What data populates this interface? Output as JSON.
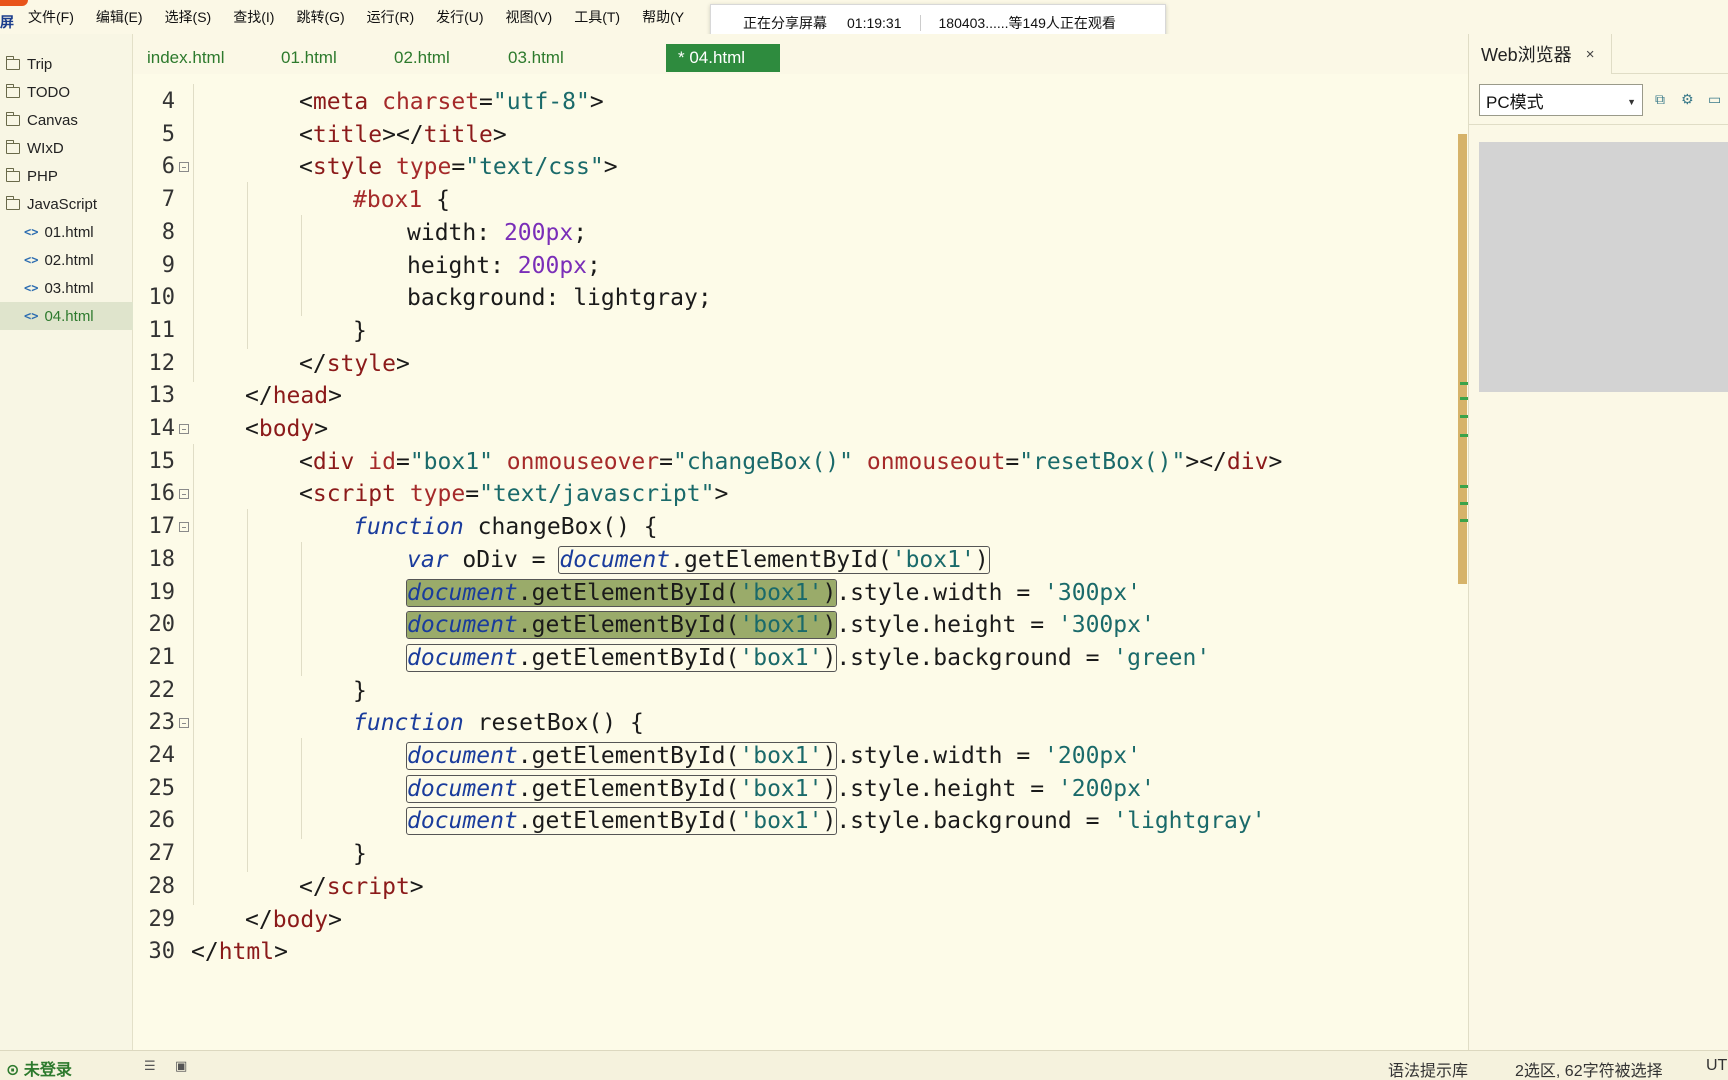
{
  "menubar": {
    "logo_text": "屏",
    "items": [
      "文件(F)",
      "编辑(E)",
      "选择(S)",
      "查找(I)",
      "跳转(G)",
      "运行(R)",
      "发行(U)",
      "视图(V)",
      "工具(T)",
      "帮助(Y"
    ]
  },
  "share_popup": {
    "status": "正在分享屏幕",
    "time": "01:19:31",
    "viewers": "180403......等149人正在观看"
  },
  "sidebar": {
    "items": [
      {
        "label": "Trip",
        "type": "folder"
      },
      {
        "label": "TODO",
        "type": "folder"
      },
      {
        "label": "Canvas",
        "type": "folder"
      },
      {
        "label": "WIxD",
        "type": "folder"
      },
      {
        "label": "PHP",
        "type": "folder"
      },
      {
        "label": "JavaScript",
        "type": "folder"
      },
      {
        "label": "01.html",
        "type": "file"
      },
      {
        "label": "02.html",
        "type": "file"
      },
      {
        "label": "03.html",
        "type": "file"
      },
      {
        "label": "04.html",
        "type": "file",
        "active": true
      }
    ]
  },
  "tabs": [
    "index.html",
    "01.html",
    "02.html",
    "03.html",
    "* 04.html"
  ],
  "active_tab_index": 4,
  "editor": {
    "lines": [
      {
        "n": "4"
      },
      {
        "n": "5"
      },
      {
        "n": "6"
      },
      {
        "n": "7"
      },
      {
        "n": "8"
      },
      {
        "n": "9"
      },
      {
        "n": "10"
      },
      {
        "n": "11"
      },
      {
        "n": "12"
      },
      {
        "n": "13"
      },
      {
        "n": "14"
      },
      {
        "n": "15"
      },
      {
        "n": "16"
      },
      {
        "n": "17"
      },
      {
        "n": "18"
      },
      {
        "n": "19"
      },
      {
        "n": "20"
      },
      {
        "n": "21"
      },
      {
        "n": "22"
      },
      {
        "n": "23"
      },
      {
        "n": "24"
      },
      {
        "n": "25"
      },
      {
        "n": "26"
      },
      {
        "n": "27"
      },
      {
        "n": "28"
      },
      {
        "n": "29"
      },
      {
        "n": "30"
      }
    ],
    "tokens": {
      "meta": "meta",
      "charset": "charset",
      "utf8": "\"utf-8\"",
      "title": "title",
      "style": "style",
      "type": "type",
      "textcss": "\"text/css\"",
      "box1sel": "#box1",
      "width": "width",
      "height": "height",
      "background": "background",
      "v200": "200px",
      "lightgray": "lightgray",
      "head": "head",
      "body": "body",
      "div": "div",
      "id": "id",
      "box1str": "\"box1\"",
      "onmouseover": "onmouseover",
      "changeBoxStr": "\"changeBox()\"",
      "onmouseout": "onmouseout",
      "resetBoxStr": "\"resetBox()\"",
      "script": "script",
      "textjs": "\"text/javascript\"",
      "function": "function",
      "changeBox": "changeBox",
      "resetBox": "resetBox",
      "var": "var",
      "oDiv": "oDiv",
      "document": "document",
      "getElementById": "getElementById",
      "box1q": "'box1'",
      "styleWidth": ".style.width = ",
      "styleHeight": ".style.height = ",
      "styleBackground": ".style.background = ",
      "v300q": "'300px'",
      "greenq": "'green'",
      "v200q": "'200px'",
      "lightgrayq": "'lightgray'",
      "html": "html"
    }
  },
  "right_panel": {
    "tab_label": "Web浏览器",
    "close": "×",
    "mode": "PC模式",
    "preview_color": "#d3d3d3"
  },
  "statusbar": {
    "login": "未登录",
    "syntax": "语法提示库",
    "selection": "2选区, 62字符被选择",
    "encoding": "UT"
  }
}
